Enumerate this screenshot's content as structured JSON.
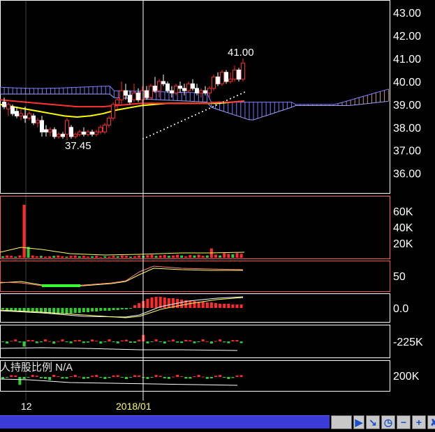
{
  "chart_data": [
    {
      "type": "candlestick",
      "panel": "price",
      "y_ticks": [
        "43.00",
        "42.00",
        "41.00",
        "40.00",
        "39.00",
        "38.00",
        "37.00",
        "36.00"
      ],
      "ylim": [
        35.2,
        43.4
      ],
      "annotations": [
        {
          "text": "41.00",
          "x": 57,
          "y": 41.0
        },
        {
          "text": "37.45",
          "x": 15,
          "y": 37.45
        }
      ],
      "candles": [
        {
          "o": 39.1,
          "h": 39.3,
          "l": 38.8,
          "c": 38.9
        },
        {
          "o": 38.8,
          "h": 39.1,
          "l": 38.5,
          "c": 39.0
        },
        {
          "o": 38.9,
          "h": 39.0,
          "l": 38.5,
          "c": 38.6
        },
        {
          "o": 38.7,
          "h": 38.9,
          "l": 38.4,
          "c": 38.5
        },
        {
          "o": 38.5,
          "h": 38.8,
          "l": 38.3,
          "c": 38.6
        },
        {
          "o": 38.5,
          "h": 38.9,
          "l": 38.2,
          "c": 38.4
        },
        {
          "o": 38.4,
          "h": 38.7,
          "l": 38.3,
          "c": 38.6
        },
        {
          "o": 38.5,
          "h": 38.6,
          "l": 38.1,
          "c": 38.2
        },
        {
          "o": 38.2,
          "h": 38.4,
          "l": 38.0,
          "c": 38.3
        },
        {
          "o": 38.3,
          "h": 38.5,
          "l": 37.6,
          "c": 37.8
        },
        {
          "o": 37.9,
          "h": 38.1,
          "l": 37.6,
          "c": 37.8
        },
        {
          "o": 37.8,
          "h": 38.0,
          "l": 37.6,
          "c": 37.9
        },
        {
          "o": 37.9,
          "h": 38.0,
          "l": 37.5,
          "c": 37.6
        },
        {
          "o": 37.6,
          "h": 37.8,
          "l": 37.5,
          "c": 37.7
        },
        {
          "o": 37.7,
          "h": 37.8,
          "l": 37.5,
          "c": 37.6
        },
        {
          "o": 37.7,
          "h": 38.4,
          "l": 37.45,
          "c": 38.3
        },
        {
          "o": 38.0,
          "h": 38.1,
          "l": 37.5,
          "c": 37.6
        },
        {
          "o": 37.6,
          "h": 37.8,
          "l": 37.5,
          "c": 37.7
        },
        {
          "o": 37.7,
          "h": 37.9,
          "l": 37.6,
          "c": 37.8
        },
        {
          "o": 37.8,
          "h": 38.0,
          "l": 37.6,
          "c": 37.7
        },
        {
          "o": 37.7,
          "h": 37.9,
          "l": 37.6,
          "c": 37.8
        },
        {
          "o": 37.8,
          "h": 37.9,
          "l": 37.6,
          "c": 37.7
        },
        {
          "o": 37.7,
          "h": 37.9,
          "l": 37.6,
          "c": 37.8
        },
        {
          "o": 37.8,
          "h": 38.1,
          "l": 37.7,
          "c": 38.0
        },
        {
          "o": 37.8,
          "h": 38.2,
          "l": 37.7,
          "c": 38.1
        },
        {
          "o": 38.1,
          "h": 38.5,
          "l": 38.0,
          "c": 38.4
        },
        {
          "o": 38.4,
          "h": 39.1,
          "l": 38.3,
          "c": 39.0
        },
        {
          "o": 39.0,
          "h": 39.3,
          "l": 38.8,
          "c": 39.2
        },
        {
          "o": 39.2,
          "h": 40.0,
          "l": 39.0,
          "c": 39.6
        },
        {
          "o": 39.6,
          "h": 39.9,
          "l": 39.2,
          "c": 39.4
        },
        {
          "o": 39.4,
          "h": 39.6,
          "l": 39.0,
          "c": 39.1
        },
        {
          "o": 39.2,
          "h": 39.9,
          "l": 39.1,
          "c": 39.5
        },
        {
          "o": 39.5,
          "h": 39.7,
          "l": 39.1,
          "c": 39.2
        },
        {
          "o": 39.2,
          "h": 39.8,
          "l": 39.0,
          "c": 39.6
        },
        {
          "o": 39.6,
          "h": 39.8,
          "l": 39.2,
          "c": 39.3
        },
        {
          "o": 39.3,
          "h": 39.9,
          "l": 39.2,
          "c": 39.8
        },
        {
          "o": 39.8,
          "h": 40.2,
          "l": 39.5,
          "c": 39.6
        },
        {
          "o": 39.6,
          "h": 40.1,
          "l": 39.3,
          "c": 40.0
        },
        {
          "o": 40.0,
          "h": 40.3,
          "l": 39.8,
          "c": 39.9
        },
        {
          "o": 39.9,
          "h": 40.0,
          "l": 39.5,
          "c": 39.6
        },
        {
          "o": 39.6,
          "h": 39.8,
          "l": 39.3,
          "c": 39.5
        },
        {
          "o": 39.5,
          "h": 39.9,
          "l": 39.4,
          "c": 39.8
        },
        {
          "o": 39.8,
          "h": 40.0,
          "l": 39.5,
          "c": 39.7
        },
        {
          "o": 39.7,
          "h": 39.9,
          "l": 39.4,
          "c": 39.6
        },
        {
          "o": 39.6,
          "h": 40.0,
          "l": 39.5,
          "c": 39.9
        },
        {
          "o": 39.9,
          "h": 40.1,
          "l": 39.6,
          "c": 39.7
        },
        {
          "o": 39.7,
          "h": 39.9,
          "l": 39.4,
          "c": 39.5
        },
        {
          "o": 39.5,
          "h": 39.7,
          "l": 39.3,
          "c": 39.6
        },
        {
          "o": 39.6,
          "h": 39.8,
          "l": 39.4,
          "c": 39.5
        },
        {
          "o": 39.5,
          "h": 39.8,
          "l": 39.3,
          "c": 39.7
        },
        {
          "o": 39.7,
          "h": 40.3,
          "l": 39.6,
          "c": 40.2
        },
        {
          "o": 40.2,
          "h": 40.4,
          "l": 39.8,
          "c": 39.9
        },
        {
          "o": 39.9,
          "h": 40.5,
          "l": 39.8,
          "c": 40.4
        },
        {
          "o": 40.4,
          "h": 40.5,
          "l": 39.9,
          "c": 40.0
        },
        {
          "o": 40.0,
          "h": 40.4,
          "l": 39.9,
          "c": 40.1
        },
        {
          "o": 40.1,
          "h": 40.7,
          "l": 40.0,
          "c": 40.5
        },
        {
          "o": 40.5,
          "h": 40.6,
          "l": 40.0,
          "c": 40.1
        },
        {
          "o": 40.1,
          "h": 41.0,
          "l": 40.0,
          "c": 40.8
        }
      ],
      "moving_averages": [
        {
          "color": "#ffff00",
          "values": [
            39.0,
            38.9,
            38.8,
            38.7,
            38.6,
            38.5,
            38.45,
            38.5,
            38.6,
            38.75,
            38.85,
            38.95,
            39.0,
            39.05,
            39.05,
            39.05,
            39.05,
            39.05,
            39.1,
            39.15
          ]
        },
        {
          "color": "#ff3333",
          "values": [
            39.2,
            39.15,
            39.1,
            39.05,
            39.0,
            38.95,
            38.9,
            38.9,
            38.9,
            38.95,
            39.0,
            39.05,
            39.05,
            39.05,
            39.05,
            39.05,
            39.05,
            39.1,
            39.1,
            39.15
          ]
        }
      ]
    },
    {
      "type": "bar",
      "panel": "volume",
      "y_ticks": [
        "60K",
        "40K",
        "20K"
      ],
      "ylim": [
        0,
        75000
      ],
      "values": [
        2000,
        3000,
        2500,
        1500,
        3000,
        68000,
        14000,
        3000,
        2000,
        2500,
        1500,
        2000,
        2500,
        3000,
        2000,
        1500,
        2500,
        3000,
        2000,
        2500,
        1500,
        2000,
        2500,
        1000,
        2000,
        1500,
        2500,
        2000,
        3000,
        2500,
        1500,
        2000,
        3000,
        2500,
        3500,
        4000,
        2500,
        3000,
        3500,
        2500,
        3000,
        4000,
        3000,
        2000,
        3500,
        3000,
        4000,
        2500,
        3000,
        12000,
        4000,
        3000,
        6000,
        5000,
        4500,
        6000,
        5000
      ]
    },
    {
      "type": "line",
      "panel": "oscillator",
      "y_ticks": [
        "50"
      ],
      "ylim": [
        0,
        100
      ]
    },
    {
      "type": "bar",
      "panel": "macd",
      "y_ticks": [
        "0.0"
      ],
      "ylim": [
        -1,
        1
      ],
      "values": [
        -0.1,
        -0.15,
        -0.2,
        -0.2,
        -0.25,
        -0.3,
        -0.3,
        -0.3,
        -0.3,
        -0.35,
        -0.4,
        -0.4,
        -0.4,
        -0.45,
        -0.4,
        -0.4,
        -0.4,
        -0.35,
        -0.35,
        -0.3,
        -0.3,
        -0.25,
        -0.25,
        -0.2,
        -0.2,
        -0.2,
        -0.15,
        -0.15,
        -0.1,
        -0.1,
        -0.05,
        0.2,
        0.35,
        0.5,
        0.65,
        0.75,
        0.8,
        0.8,
        0.75,
        0.7,
        0.7,
        0.65,
        0.6,
        0.55,
        0.5,
        0.5,
        0.45,
        0.45,
        0.4,
        0.4,
        0.35,
        0.3,
        0.3,
        0.3,
        0.25,
        0.25,
        0.25
      ]
    },
    {
      "type": "bar",
      "panel": "foreign",
      "y_ticks": [
        "-225K"
      ],
      "ylim": [
        -1,
        1
      ]
    },
    {
      "type": "bar",
      "panel": "holders",
      "y_ticks": [
        "200K"
      ],
      "ylim": [
        -1,
        1
      ]
    }
  ],
  "holders_label": "人持股比例 N/A",
  "x_labels": {
    "left": "12",
    "mid": "2018/01"
  },
  "toolbar": [
    "▶",
    "↘",
    "◷",
    "−",
    "+",
    "✘"
  ]
}
